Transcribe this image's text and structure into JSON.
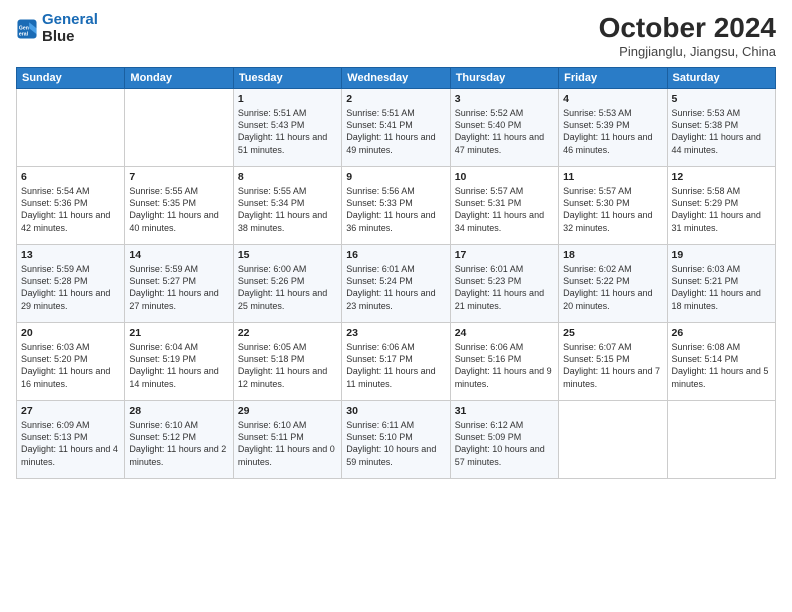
{
  "logo": {
    "line1": "General",
    "line2": "Blue"
  },
  "title": "October 2024",
  "subtitle": "Pingjianglu, Jiangsu, China",
  "days_header": [
    "Sunday",
    "Monday",
    "Tuesday",
    "Wednesday",
    "Thursday",
    "Friday",
    "Saturday"
  ],
  "weeks": [
    [
      {
        "num": "",
        "info": ""
      },
      {
        "num": "",
        "info": ""
      },
      {
        "num": "1",
        "info": "Sunrise: 5:51 AM\nSunset: 5:43 PM\nDaylight: 11 hours and 51 minutes."
      },
      {
        "num": "2",
        "info": "Sunrise: 5:51 AM\nSunset: 5:41 PM\nDaylight: 11 hours and 49 minutes."
      },
      {
        "num": "3",
        "info": "Sunrise: 5:52 AM\nSunset: 5:40 PM\nDaylight: 11 hours and 47 minutes."
      },
      {
        "num": "4",
        "info": "Sunrise: 5:53 AM\nSunset: 5:39 PM\nDaylight: 11 hours and 46 minutes."
      },
      {
        "num": "5",
        "info": "Sunrise: 5:53 AM\nSunset: 5:38 PM\nDaylight: 11 hours and 44 minutes."
      }
    ],
    [
      {
        "num": "6",
        "info": "Sunrise: 5:54 AM\nSunset: 5:36 PM\nDaylight: 11 hours and 42 minutes."
      },
      {
        "num": "7",
        "info": "Sunrise: 5:55 AM\nSunset: 5:35 PM\nDaylight: 11 hours and 40 minutes."
      },
      {
        "num": "8",
        "info": "Sunrise: 5:55 AM\nSunset: 5:34 PM\nDaylight: 11 hours and 38 minutes."
      },
      {
        "num": "9",
        "info": "Sunrise: 5:56 AM\nSunset: 5:33 PM\nDaylight: 11 hours and 36 minutes."
      },
      {
        "num": "10",
        "info": "Sunrise: 5:57 AM\nSunset: 5:31 PM\nDaylight: 11 hours and 34 minutes."
      },
      {
        "num": "11",
        "info": "Sunrise: 5:57 AM\nSunset: 5:30 PM\nDaylight: 11 hours and 32 minutes."
      },
      {
        "num": "12",
        "info": "Sunrise: 5:58 AM\nSunset: 5:29 PM\nDaylight: 11 hours and 31 minutes."
      }
    ],
    [
      {
        "num": "13",
        "info": "Sunrise: 5:59 AM\nSunset: 5:28 PM\nDaylight: 11 hours and 29 minutes."
      },
      {
        "num": "14",
        "info": "Sunrise: 5:59 AM\nSunset: 5:27 PM\nDaylight: 11 hours and 27 minutes."
      },
      {
        "num": "15",
        "info": "Sunrise: 6:00 AM\nSunset: 5:26 PM\nDaylight: 11 hours and 25 minutes."
      },
      {
        "num": "16",
        "info": "Sunrise: 6:01 AM\nSunset: 5:24 PM\nDaylight: 11 hours and 23 minutes."
      },
      {
        "num": "17",
        "info": "Sunrise: 6:01 AM\nSunset: 5:23 PM\nDaylight: 11 hours and 21 minutes."
      },
      {
        "num": "18",
        "info": "Sunrise: 6:02 AM\nSunset: 5:22 PM\nDaylight: 11 hours and 20 minutes."
      },
      {
        "num": "19",
        "info": "Sunrise: 6:03 AM\nSunset: 5:21 PM\nDaylight: 11 hours and 18 minutes."
      }
    ],
    [
      {
        "num": "20",
        "info": "Sunrise: 6:03 AM\nSunset: 5:20 PM\nDaylight: 11 hours and 16 minutes."
      },
      {
        "num": "21",
        "info": "Sunrise: 6:04 AM\nSunset: 5:19 PM\nDaylight: 11 hours and 14 minutes."
      },
      {
        "num": "22",
        "info": "Sunrise: 6:05 AM\nSunset: 5:18 PM\nDaylight: 11 hours and 12 minutes."
      },
      {
        "num": "23",
        "info": "Sunrise: 6:06 AM\nSunset: 5:17 PM\nDaylight: 11 hours and 11 minutes."
      },
      {
        "num": "24",
        "info": "Sunrise: 6:06 AM\nSunset: 5:16 PM\nDaylight: 11 hours and 9 minutes."
      },
      {
        "num": "25",
        "info": "Sunrise: 6:07 AM\nSunset: 5:15 PM\nDaylight: 11 hours and 7 minutes."
      },
      {
        "num": "26",
        "info": "Sunrise: 6:08 AM\nSunset: 5:14 PM\nDaylight: 11 hours and 5 minutes."
      }
    ],
    [
      {
        "num": "27",
        "info": "Sunrise: 6:09 AM\nSunset: 5:13 PM\nDaylight: 11 hours and 4 minutes."
      },
      {
        "num": "28",
        "info": "Sunrise: 6:10 AM\nSunset: 5:12 PM\nDaylight: 11 hours and 2 minutes."
      },
      {
        "num": "29",
        "info": "Sunrise: 6:10 AM\nSunset: 5:11 PM\nDaylight: 11 hours and 0 minutes."
      },
      {
        "num": "30",
        "info": "Sunrise: 6:11 AM\nSunset: 5:10 PM\nDaylight: 10 hours and 59 minutes."
      },
      {
        "num": "31",
        "info": "Sunrise: 6:12 AM\nSunset: 5:09 PM\nDaylight: 10 hours and 57 minutes."
      },
      {
        "num": "",
        "info": ""
      },
      {
        "num": "",
        "info": ""
      }
    ]
  ]
}
